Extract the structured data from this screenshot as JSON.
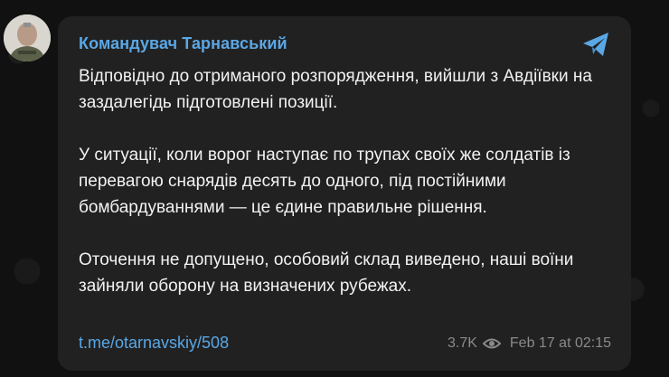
{
  "post": {
    "sender": "Командувач Тарнавський",
    "paragraphs": [
      "Відповідно до отриманого розпорядження, вийшли з Авдіївки на заздалегідь підготовлені позиції.",
      "У ситуації, коли ворог наступає по трупах своїх же солдатів із перевагою снарядів десять до одного, під постійними бомбардуваннями — це єдине правильне рішення.",
      "Оточення не допущено, особовий склад виведено, наші воїни зайняли оборону на визначених рубежах."
    ],
    "link": "t.me/otarnavskiy/508",
    "views": "3.7K",
    "timestamp": "Feb 17 at 02:15"
  },
  "icons": {
    "share": "telegram-share-icon",
    "views": "eye-icon"
  },
  "colors": {
    "accent": "#5aa7e6",
    "bubble": "#212121",
    "text": "#f2f2f2",
    "meta": "#8a8a8a"
  }
}
